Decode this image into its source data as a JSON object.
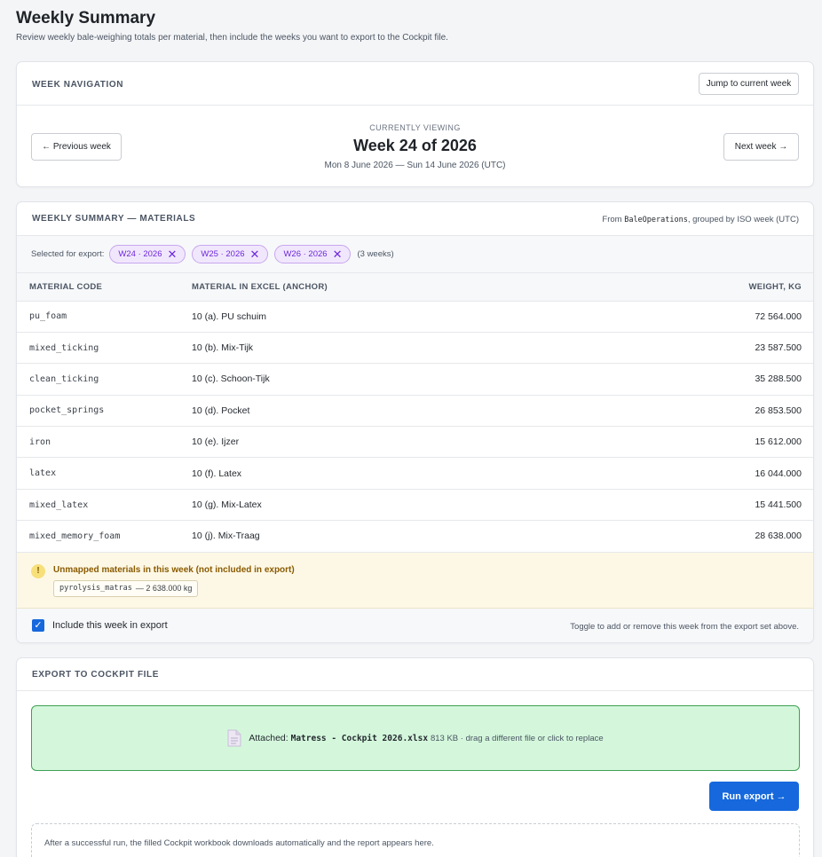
{
  "page": {
    "title": "Weekly Summary",
    "subtitle": "Review weekly bale-weighing totals per material, then include the weeks you want to export to the Cockpit file."
  },
  "week_nav": {
    "title": "Week navigation",
    "jump_label": "Jump to current week",
    "prev_label": "← Previous week",
    "next_label": "Next week →",
    "viewing_label": "Currently viewing",
    "week_heading": "Week 24 of 2026",
    "week_range": "Mon 8 June 2026 — Sun 14 June 2026 (UTC)"
  },
  "summary": {
    "title": "Weekly summary — materials",
    "source_prefix": "From ",
    "source_code": "BaleOperations",
    "source_suffix": ", grouped by ISO week (UTC)",
    "export_label": "Selected for export:",
    "selected_weeks": [
      "W24 · 2026",
      "W25 · 2026",
      "W26 · 2026"
    ],
    "week_count": "(3 weeks)",
    "columns": [
      "Material code",
      "Material in Excel (anchor)",
      "Weight, kg"
    ],
    "rows": [
      {
        "code": "pu_foam",
        "anchor": "10 (a). PU schuim",
        "weight": "72 564.000"
      },
      {
        "code": "mixed_ticking",
        "anchor": "10 (b). Mix-Tijk",
        "weight": "23 587.500"
      },
      {
        "code": "clean_ticking",
        "anchor": "10 (c). Schoon-Tijk",
        "weight": "35 288.500"
      },
      {
        "code": "pocket_springs",
        "anchor": "10 (d). Pocket",
        "weight": "26 853.500"
      },
      {
        "code": "iron",
        "anchor": "10 (e). Ijzer",
        "weight": "15 612.000"
      },
      {
        "code": "latex",
        "anchor": "10 (f). Latex",
        "weight": "16 044.000"
      },
      {
        "code": "mixed_latex",
        "anchor": "10 (g). Mix-Latex",
        "weight": "15 441.500"
      },
      {
        "code": "mixed_memory_foam",
        "anchor": "10 (j). Mix-Traag",
        "weight": "28 638.000"
      }
    ],
    "warning": {
      "icon": "!",
      "title": "Unmapped materials in this week (not included in export)",
      "item_code": "pyrolysis_matras",
      "item_value": "— 2 638.000 kg"
    },
    "include_label": "Include this week in export",
    "include_checked": true,
    "include_hint": "Toggle to add or remove this week from the export set above."
  },
  "export": {
    "title": "Export to Cockpit file",
    "attached_label": "Attached: ",
    "file_name": "Matress - Cockpit 2026.xlsx",
    "file_meta": "813 KB · drag a different file or click to replace",
    "run_label": "Run export →",
    "report_text": "After a successful run, the filled Cockpit workbook downloads automatically and the report appears here."
  },
  "colors": {
    "accent": "#1668dc",
    "chip_bg": "#f1e7fd",
    "dropzone_bg": "#d4f7dc",
    "warning_bg": "#fdf8e6"
  }
}
